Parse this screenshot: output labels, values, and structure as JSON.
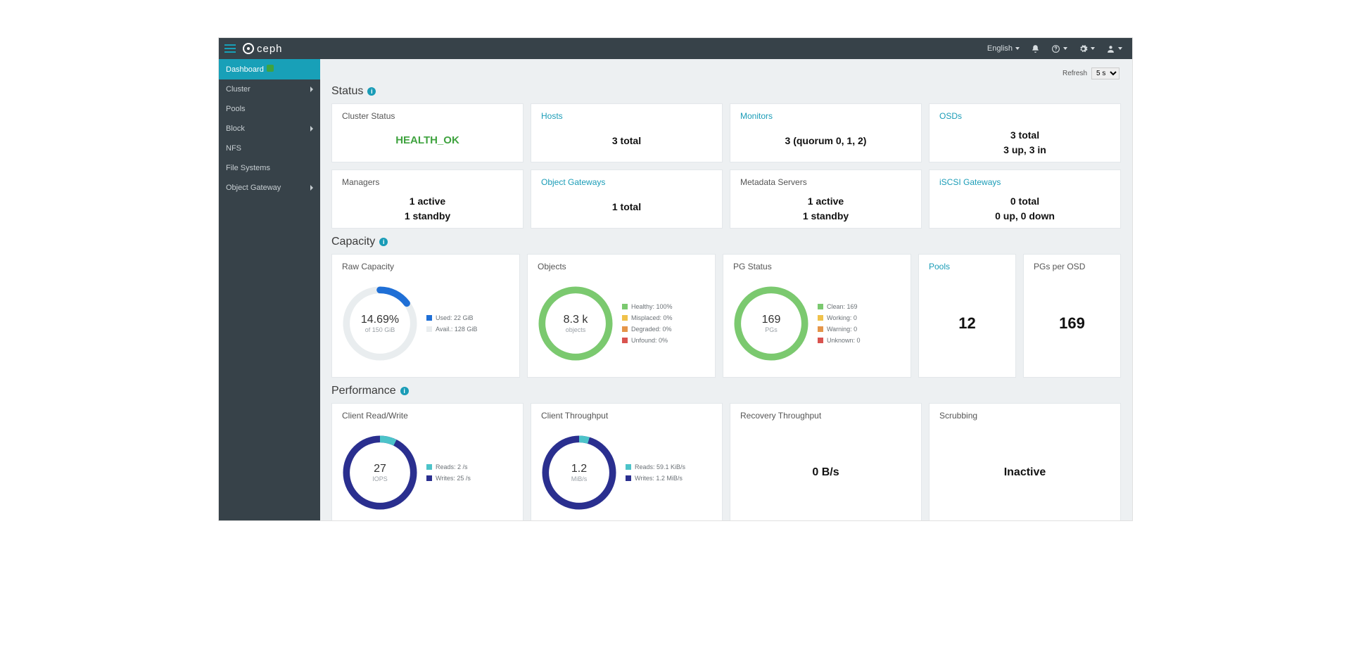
{
  "header": {
    "brand": "ceph",
    "language": "English",
    "refresh_label": "Refresh",
    "refresh_value": "5 s"
  },
  "sidebar": {
    "items": [
      {
        "label": "Dashboard",
        "active": true,
        "badge": true
      },
      {
        "label": "Cluster",
        "chevron": true
      },
      {
        "label": "Pools"
      },
      {
        "label": "Block",
        "chevron": true
      },
      {
        "label": "NFS"
      },
      {
        "label": "File Systems"
      },
      {
        "label": "Object Gateway",
        "chevron": true
      }
    ]
  },
  "sections": {
    "status": "Status",
    "capacity": "Capacity",
    "performance": "Performance"
  },
  "status": {
    "cluster_status": {
      "title": "Cluster Status",
      "value": "HEALTH_OK"
    },
    "hosts": {
      "title": "Hosts",
      "value": "3 total"
    },
    "monitors": {
      "title": "Monitors",
      "value": "3 (quorum 0, 1, 2)"
    },
    "osds": {
      "title": "OSDs",
      "line1": "3 total",
      "line2": "3 up, 3 in"
    },
    "managers": {
      "title": "Managers",
      "line1": "1 active",
      "line2": "1 standby"
    },
    "obj_gw": {
      "title": "Object Gateways",
      "value": "1 total"
    },
    "mds": {
      "title": "Metadata Servers",
      "line1": "1 active",
      "line2": "1 standby"
    },
    "iscsi": {
      "title": "iSCSI Gateways",
      "line1": "0 total",
      "line2": "0 up, 0 down"
    }
  },
  "capacity": {
    "raw": {
      "title": "Raw Capacity",
      "pct": "14.69%",
      "of": "of 150 GiB",
      "used_label": "Used: 22 GiB",
      "avail_label": "Avail.: 128 GiB",
      "used_color": "#1f6fd6",
      "avail_color": "#e9edef",
      "used_frac": 0.1469
    },
    "objects": {
      "title": "Objects",
      "big": "8.3 k",
      "sub": "objects",
      "legend": [
        {
          "c": "#7bc96f",
          "t": "Healthy: 100%"
        },
        {
          "c": "#f0c24b",
          "t": "Misplaced: 0%"
        },
        {
          "c": "#e59549",
          "t": "Degraded: 0%"
        },
        {
          "c": "#d9534f",
          "t": "Unfound: 0%"
        }
      ],
      "ring_color": "#7bc96f"
    },
    "pg": {
      "title": "PG Status",
      "big": "169",
      "sub": "PGs",
      "legend": [
        {
          "c": "#7bc96f",
          "t": "Clean: 169"
        },
        {
          "c": "#f0c24b",
          "t": "Working: 0"
        },
        {
          "c": "#e59549",
          "t": "Warning: 0"
        },
        {
          "c": "#d9534f",
          "t": "Unknown: 0"
        }
      ],
      "ring_color": "#7bc96f"
    },
    "pools": {
      "title": "Pools",
      "value": "12"
    },
    "pgs_per_osd": {
      "title": "PGs per OSD",
      "value": "169"
    }
  },
  "performance": {
    "crw": {
      "title": "Client Read/Write",
      "big": "27",
      "sub": "IOPS",
      "legend": [
        {
          "c": "#4cc3c9",
          "t": "Reads: 2 /s"
        },
        {
          "c": "#2a2f8f",
          "t": "Writes: 25 /s"
        }
      ],
      "seg1_frac": 0.074,
      "seg1_color": "#4cc3c9",
      "seg2_color": "#2a2f8f"
    },
    "ct": {
      "title": "Client Throughput",
      "big": "1.2",
      "sub": "MiB/s",
      "legend": [
        {
          "c": "#4cc3c9",
          "t": "Reads: 59.1 KiB/s"
        },
        {
          "c": "#2a2f8f",
          "t": "Writes: 1.2 MiB/s"
        }
      ],
      "seg1_frac": 0.046,
      "seg1_color": "#4cc3c9",
      "seg2_color": "#2a2f8f"
    },
    "recovery": {
      "title": "Recovery Throughput",
      "value": "0 B/s"
    },
    "scrub": {
      "title": "Scrubbing",
      "value": "Inactive"
    }
  },
  "chart_data": [
    {
      "type": "pie",
      "title": "Raw Capacity",
      "series": [
        {
          "name": "Used",
          "value": 22,
          "unit": "GiB"
        },
        {
          "name": "Avail.",
          "value": 128,
          "unit": "GiB"
        }
      ],
      "total": "150 GiB",
      "percent_used": 14.69
    },
    {
      "type": "pie",
      "title": "Objects",
      "total": "8.3 k",
      "series": [
        {
          "name": "Healthy",
          "value": 100,
          "unit": "%"
        },
        {
          "name": "Misplaced",
          "value": 0,
          "unit": "%"
        },
        {
          "name": "Degraded",
          "value": 0,
          "unit": "%"
        },
        {
          "name": "Unfound",
          "value": 0,
          "unit": "%"
        }
      ]
    },
    {
      "type": "pie",
      "title": "PG Status",
      "total": 169,
      "series": [
        {
          "name": "Clean",
          "value": 169
        },
        {
          "name": "Working",
          "value": 0
        },
        {
          "name": "Warning",
          "value": 0
        },
        {
          "name": "Unknown",
          "value": 0
        }
      ]
    },
    {
      "type": "pie",
      "title": "Client Read/Write",
      "total": 27,
      "unit": "IOPS",
      "series": [
        {
          "name": "Reads",
          "value": 2,
          "unit": "/s"
        },
        {
          "name": "Writes",
          "value": 25,
          "unit": "/s"
        }
      ]
    },
    {
      "type": "pie",
      "title": "Client Throughput",
      "total": 1.2,
      "unit": "MiB/s",
      "series": [
        {
          "name": "Reads",
          "value": 59.1,
          "unit": "KiB/s"
        },
        {
          "name": "Writes",
          "value": 1.2,
          "unit": "MiB/s"
        }
      ]
    }
  ]
}
